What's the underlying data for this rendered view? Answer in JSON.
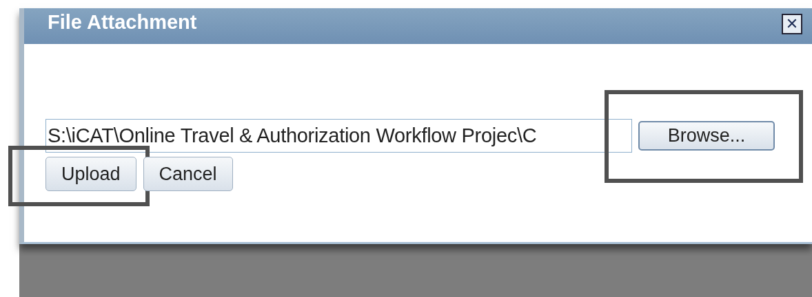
{
  "dialog": {
    "title": "File Attachment",
    "close_icon": "✕"
  },
  "file_field": {
    "value": "S:\\iCAT\\Online Travel & Authorization Workflow Projec\\C"
  },
  "buttons": [
    {
      "label": "Browse...",
      "kind": "browse",
      "highlighted": true
    },
    {
      "label": "Upload",
      "kind": "action",
      "highlighted": true
    },
    {
      "label": "Cancel",
      "kind": "action",
      "highlighted": false
    }
  ]
}
